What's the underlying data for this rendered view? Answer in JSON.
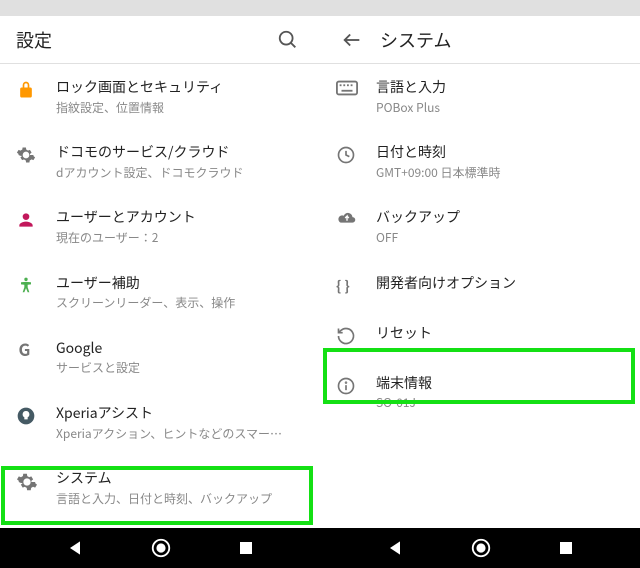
{
  "left": {
    "title": "設定",
    "items": [
      {
        "title": "ロック画面とセキュリティ",
        "sub": "指紋設定、位置情報"
      },
      {
        "title": "ドコモのサービス/クラウド",
        "sub": "dアカウント設定、ドコモクラウド"
      },
      {
        "title": "ユーザーとアカウント",
        "sub": "現在のユーザー：2"
      },
      {
        "title": "ユーザー補助",
        "sub": "スクリーンリーダー、表示、操作"
      },
      {
        "title": "Google",
        "sub": "サービスと設定"
      },
      {
        "title": "Xperiaアシスト",
        "sub": "Xperiaアクション、ヒントなどのスマー…"
      },
      {
        "title": "システム",
        "sub": "言語と入力、日付と時刻、バックアップ"
      }
    ]
  },
  "right": {
    "title": "システム",
    "items": [
      {
        "title": "言語と入力",
        "sub": "POBox Plus"
      },
      {
        "title": "日付と時刻",
        "sub": "GMT+09:00 日本標準時"
      },
      {
        "title": "バックアップ",
        "sub": "OFF"
      },
      {
        "title": "開発者向けオプション",
        "sub": ""
      },
      {
        "title": "リセット",
        "sub": ""
      },
      {
        "title": "端末情報",
        "sub": "SO-01J"
      }
    ]
  }
}
